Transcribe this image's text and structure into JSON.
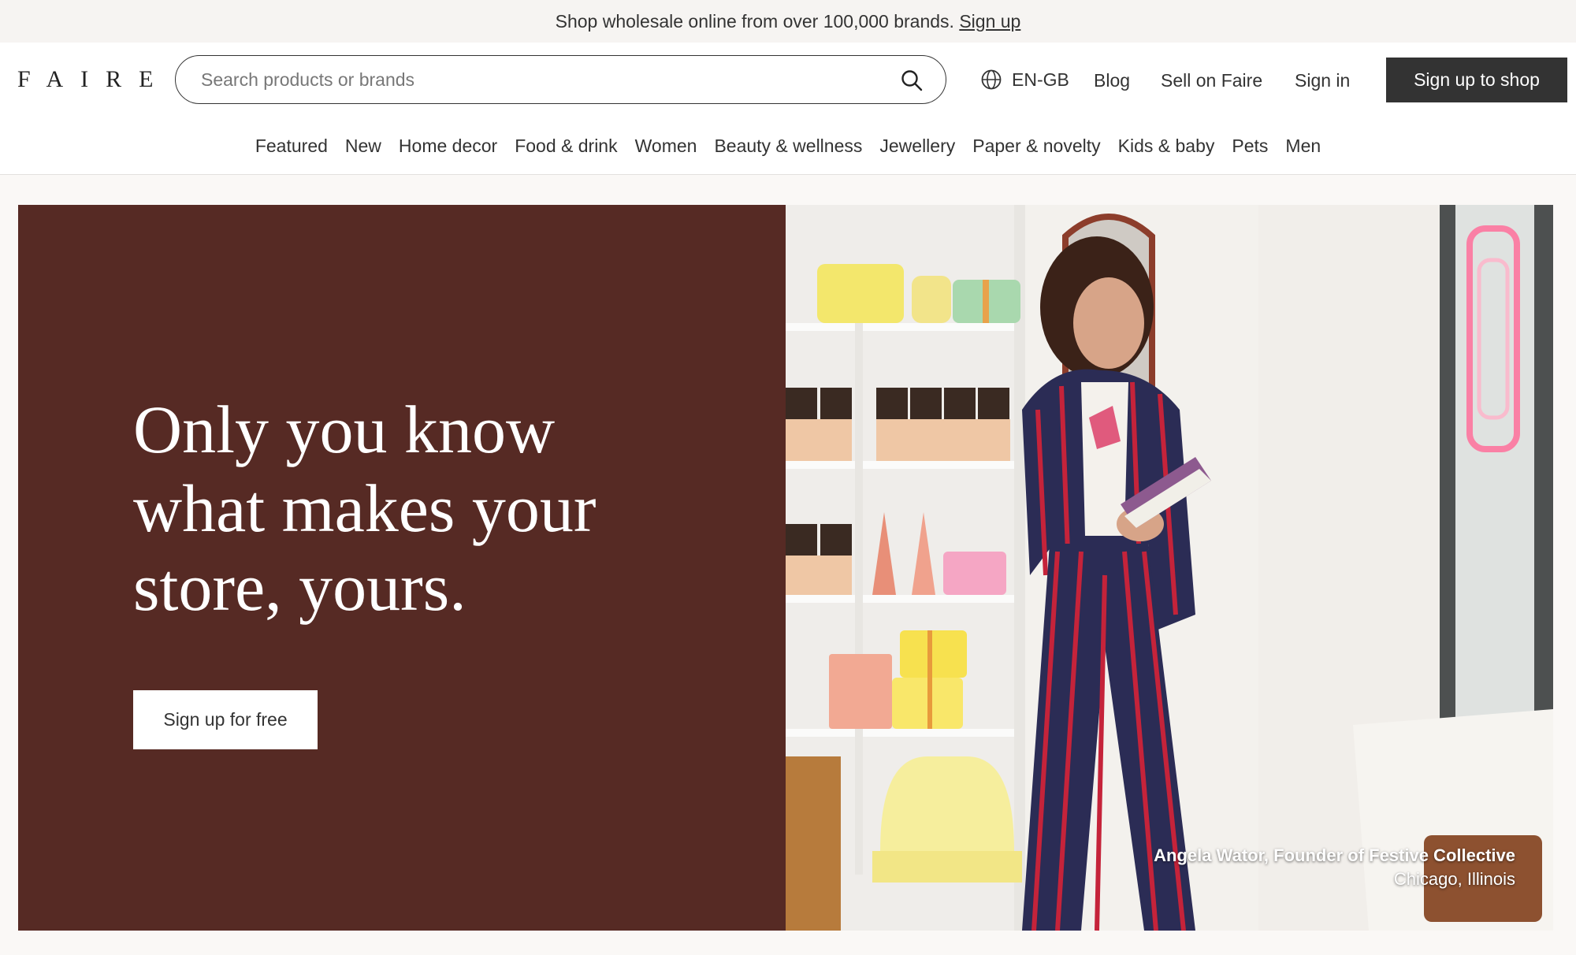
{
  "promo": {
    "text": "Shop wholesale online from over 100,000 brands.",
    "link": "Sign up"
  },
  "header": {
    "logo": "FAIRE",
    "search_placeholder": "Search products or brands",
    "language": "EN-GB",
    "blog": "Blog",
    "sell": "Sell on Faire",
    "sign_in": "Sign in",
    "cta": "Sign up to shop"
  },
  "categories": [
    "Featured",
    "New",
    "Home decor",
    "Food & drink",
    "Women",
    "Beauty & wellness",
    "Jewellery",
    "Paper & novelty",
    "Kids & baby",
    "Pets",
    "Men"
  ],
  "hero": {
    "headline": "Only you know what makes your store, yours.",
    "cta": "Sign up for free",
    "caption_name": "Angela Wator, Founder of Festive Collective",
    "caption_location": "Chicago, Illinois"
  },
  "colors": {
    "hero_background": "#562a24",
    "primary_button": "#333333"
  }
}
